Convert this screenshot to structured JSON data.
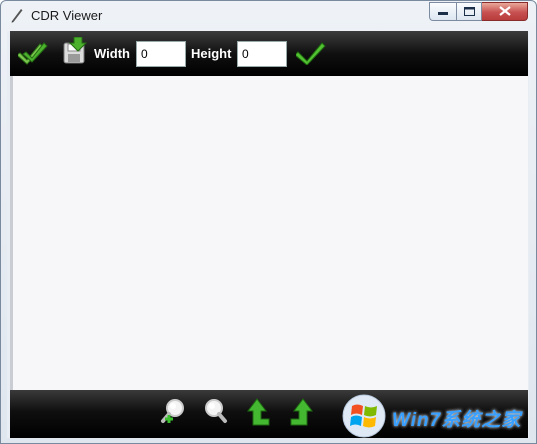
{
  "window": {
    "title": "CDR Viewer",
    "controls": [
      "minimize-icon",
      "maximize-icon",
      "close-icon"
    ]
  },
  "toolbar_top": {
    "buttons": [
      {
        "name": "apply-check",
        "icon": "double-check-icon"
      },
      {
        "name": "save",
        "icon": "save-disk-icon"
      }
    ],
    "width": {
      "label": "Width",
      "value": "0"
    },
    "height": {
      "label": "Height",
      "value": "0"
    },
    "confirm": {
      "icon": "check-icon"
    }
  },
  "toolbar_bottom": {
    "buttons": [
      {
        "name": "zoom-in",
        "icon": "zoom-in-icon"
      },
      {
        "name": "zoom-out",
        "icon": "zoom-out-icon"
      },
      {
        "name": "rotate-left",
        "icon": "rotate-left-icon"
      },
      {
        "name": "rotate-right",
        "icon": "rotate-right-icon"
      }
    ]
  },
  "watermark": {
    "text": "Win7系统之家"
  },
  "colors": {
    "toolbar": "#000000",
    "accent_green": "#3bbf2e",
    "canvas": "#f7f7f9"
  }
}
